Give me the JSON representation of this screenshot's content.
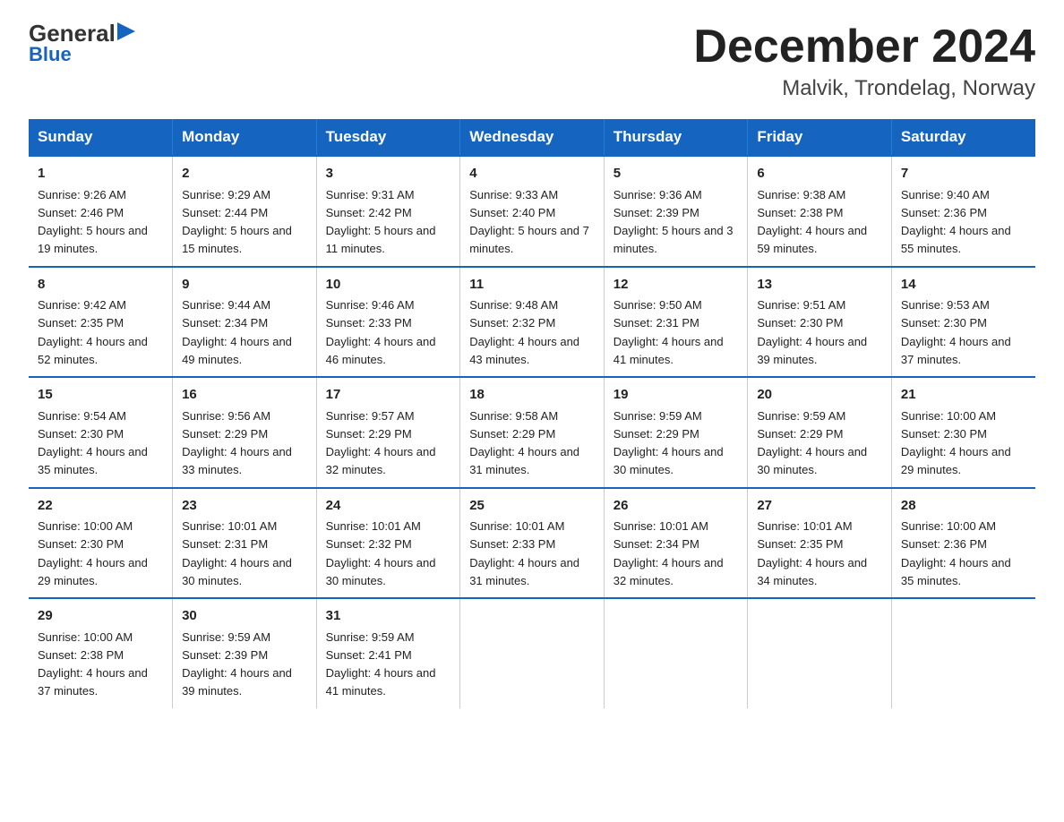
{
  "header": {
    "logo_line1": "General",
    "logo_line2": "Blue",
    "title": "December 2024",
    "subtitle": "Malvik, Trondelag, Norway"
  },
  "days_of_week": [
    "Sunday",
    "Monday",
    "Tuesday",
    "Wednesday",
    "Thursday",
    "Friday",
    "Saturday"
  ],
  "weeks": [
    [
      {
        "day": "1",
        "sunrise": "9:26 AM",
        "sunset": "2:46 PM",
        "daylight": "5 hours and 19 minutes."
      },
      {
        "day": "2",
        "sunrise": "9:29 AM",
        "sunset": "2:44 PM",
        "daylight": "5 hours and 15 minutes."
      },
      {
        "day": "3",
        "sunrise": "9:31 AM",
        "sunset": "2:42 PM",
        "daylight": "5 hours and 11 minutes."
      },
      {
        "day": "4",
        "sunrise": "9:33 AM",
        "sunset": "2:40 PM",
        "daylight": "5 hours and 7 minutes."
      },
      {
        "day": "5",
        "sunrise": "9:36 AM",
        "sunset": "2:39 PM",
        "daylight": "5 hours and 3 minutes."
      },
      {
        "day": "6",
        "sunrise": "9:38 AM",
        "sunset": "2:38 PM",
        "daylight": "4 hours and 59 minutes."
      },
      {
        "day": "7",
        "sunrise": "9:40 AM",
        "sunset": "2:36 PM",
        "daylight": "4 hours and 55 minutes."
      }
    ],
    [
      {
        "day": "8",
        "sunrise": "9:42 AM",
        "sunset": "2:35 PM",
        "daylight": "4 hours and 52 minutes."
      },
      {
        "day": "9",
        "sunrise": "9:44 AM",
        "sunset": "2:34 PM",
        "daylight": "4 hours and 49 minutes."
      },
      {
        "day": "10",
        "sunrise": "9:46 AM",
        "sunset": "2:33 PM",
        "daylight": "4 hours and 46 minutes."
      },
      {
        "day": "11",
        "sunrise": "9:48 AM",
        "sunset": "2:32 PM",
        "daylight": "4 hours and 43 minutes."
      },
      {
        "day": "12",
        "sunrise": "9:50 AM",
        "sunset": "2:31 PM",
        "daylight": "4 hours and 41 minutes."
      },
      {
        "day": "13",
        "sunrise": "9:51 AM",
        "sunset": "2:30 PM",
        "daylight": "4 hours and 39 minutes."
      },
      {
        "day": "14",
        "sunrise": "9:53 AM",
        "sunset": "2:30 PM",
        "daylight": "4 hours and 37 minutes."
      }
    ],
    [
      {
        "day": "15",
        "sunrise": "9:54 AM",
        "sunset": "2:30 PM",
        "daylight": "4 hours and 35 minutes."
      },
      {
        "day": "16",
        "sunrise": "9:56 AM",
        "sunset": "2:29 PM",
        "daylight": "4 hours and 33 minutes."
      },
      {
        "day": "17",
        "sunrise": "9:57 AM",
        "sunset": "2:29 PM",
        "daylight": "4 hours and 32 minutes."
      },
      {
        "day": "18",
        "sunrise": "9:58 AM",
        "sunset": "2:29 PM",
        "daylight": "4 hours and 31 minutes."
      },
      {
        "day": "19",
        "sunrise": "9:59 AM",
        "sunset": "2:29 PM",
        "daylight": "4 hours and 30 minutes."
      },
      {
        "day": "20",
        "sunrise": "9:59 AM",
        "sunset": "2:29 PM",
        "daylight": "4 hours and 30 minutes."
      },
      {
        "day": "21",
        "sunrise": "10:00 AM",
        "sunset": "2:30 PM",
        "daylight": "4 hours and 29 minutes."
      }
    ],
    [
      {
        "day": "22",
        "sunrise": "10:00 AM",
        "sunset": "2:30 PM",
        "daylight": "4 hours and 29 minutes."
      },
      {
        "day": "23",
        "sunrise": "10:01 AM",
        "sunset": "2:31 PM",
        "daylight": "4 hours and 30 minutes."
      },
      {
        "day": "24",
        "sunrise": "10:01 AM",
        "sunset": "2:32 PM",
        "daylight": "4 hours and 30 minutes."
      },
      {
        "day": "25",
        "sunrise": "10:01 AM",
        "sunset": "2:33 PM",
        "daylight": "4 hours and 31 minutes."
      },
      {
        "day": "26",
        "sunrise": "10:01 AM",
        "sunset": "2:34 PM",
        "daylight": "4 hours and 32 minutes."
      },
      {
        "day": "27",
        "sunrise": "10:01 AM",
        "sunset": "2:35 PM",
        "daylight": "4 hours and 34 minutes."
      },
      {
        "day": "28",
        "sunrise": "10:00 AM",
        "sunset": "2:36 PM",
        "daylight": "4 hours and 35 minutes."
      }
    ],
    [
      {
        "day": "29",
        "sunrise": "10:00 AM",
        "sunset": "2:38 PM",
        "daylight": "4 hours and 37 minutes."
      },
      {
        "day": "30",
        "sunrise": "9:59 AM",
        "sunset": "2:39 PM",
        "daylight": "4 hours and 39 minutes."
      },
      {
        "day": "31",
        "sunrise": "9:59 AM",
        "sunset": "2:41 PM",
        "daylight": "4 hours and 41 minutes."
      },
      null,
      null,
      null,
      null
    ]
  ]
}
